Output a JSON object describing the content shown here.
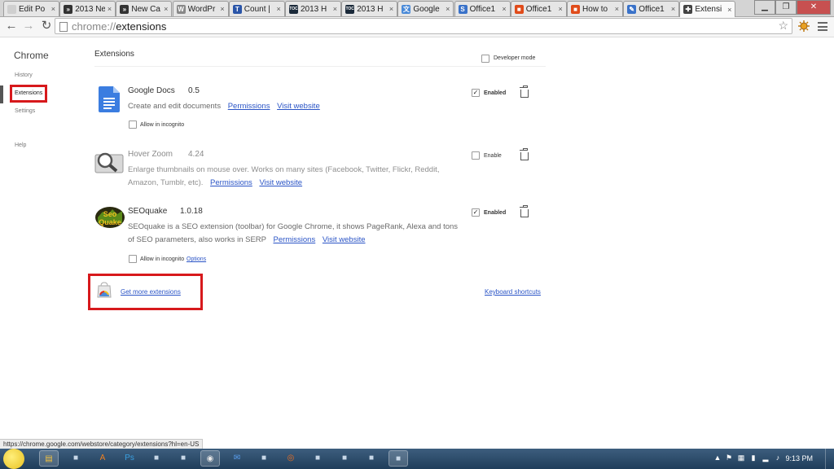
{
  "tabs": [
    {
      "title": "Edit Po",
      "favicon_color": "#cfcfcf",
      "glyph": ""
    },
    {
      "title": "2013 Ne",
      "favicon_color": "#333333",
      "glyph": "»"
    },
    {
      "title": "New Ca",
      "favicon_color": "#333333",
      "glyph": "»"
    },
    {
      "title": "WordPr",
      "favicon_color": "#888888",
      "glyph": "W"
    },
    {
      "title": "Count |",
      "favicon_color": "#2a55a8",
      "glyph": "T"
    },
    {
      "title": "2013 H",
      "favicon_color": "#1b2a3a",
      "glyph": "TOC"
    },
    {
      "title": "2013 H",
      "favicon_color": "#1b2a3a",
      "glyph": "TOC"
    },
    {
      "title": "Google",
      "favicon_color": "#4a8ad8",
      "glyph": "文"
    },
    {
      "title": "Office1",
      "favicon_color": "#3a72c9",
      "glyph": "S"
    },
    {
      "title": "Office1",
      "favicon_color": "#e04b1a",
      "glyph": "■"
    },
    {
      "title": "How to",
      "favicon_color": "#e04b1a",
      "glyph": "■"
    },
    {
      "title": "Office1",
      "favicon_color": "#3a72c9",
      "glyph": "✎"
    },
    {
      "title": "Extensi",
      "favicon_color": "#444444",
      "glyph": "✚"
    }
  ],
  "tab_close": "×",
  "window_controls": {
    "minimize": "▁",
    "maximize": "❐",
    "close": "✕"
  },
  "toolbar": {
    "back": "←",
    "forward": "→",
    "reload": "↻",
    "url_scheme": "chrome://",
    "url_path": "extensions",
    "star": "☆",
    "icons": [
      "star-icon",
      "extension-sun-icon",
      "menu-icon"
    ]
  },
  "sidebar": {
    "title": "Chrome",
    "items": [
      "History",
      "Extensions",
      "Settings",
      "Help"
    ],
    "active": "Extensions"
  },
  "main": {
    "title": "Extensions",
    "developer_mode_label": "Developer mode",
    "developer_mode": false,
    "extensions": [
      {
        "name": "Google Docs",
        "version": "0.5",
        "description": "Create and edit documents",
        "permissions": "Permissions",
        "visit": "Visit website",
        "enabled_label": "Enabled",
        "enabled": true,
        "incognito_label": "Allow in incognito",
        "incognito": false,
        "icon": "google-docs-icon"
      },
      {
        "name": "Hover Zoom",
        "version": "4.24",
        "description_1": "Enlarge thumbnails on mouse over. Works on many sites (Facebook, Twitter, Flickr, Reddit,",
        "description_2": "Amazon, Tumblr, etc).",
        "permissions": "Permissions",
        "visit": "Visit website",
        "enabled_label": "Enable",
        "enabled": false,
        "icon": "hover-zoom-icon"
      },
      {
        "name": "SEOquake",
        "version": "1.0.18",
        "description_1": "SEOquake is a SEO extension (toolbar) for Google Chrome, it shows PageRank, Alexa and tons",
        "description_2": "of SEO parameters, also works in SERP",
        "permissions": "Permissions",
        "visit": "Visit website",
        "enabled_label": "Enabled",
        "enabled": true,
        "incognito_label": "Allow in incognito",
        "incognito": false,
        "options": "Options",
        "icon": "seoquake-icon",
        "logo_text": "Seo Quake"
      }
    ],
    "get_more": "Get more extensions",
    "keyboard_shortcuts": "Keyboard shortcuts"
  },
  "status_url": "https://chrome.google.com/webstore/category/extensions?hl=en-US",
  "taskbar": {
    "apps": [
      "explorer-icon",
      "app-icon",
      "avast-icon",
      "photoshop-icon",
      "app-icon",
      "app-icon",
      "chrome-icon",
      "thunderbird-icon",
      "app-icon",
      "firefox-icon",
      "app-icon",
      "app-icon",
      "app-icon",
      "app-icon"
    ],
    "clock": "9:13 PM"
  },
  "colors": {
    "highlight_box": "#d7191c",
    "link": "#2a54c6"
  }
}
